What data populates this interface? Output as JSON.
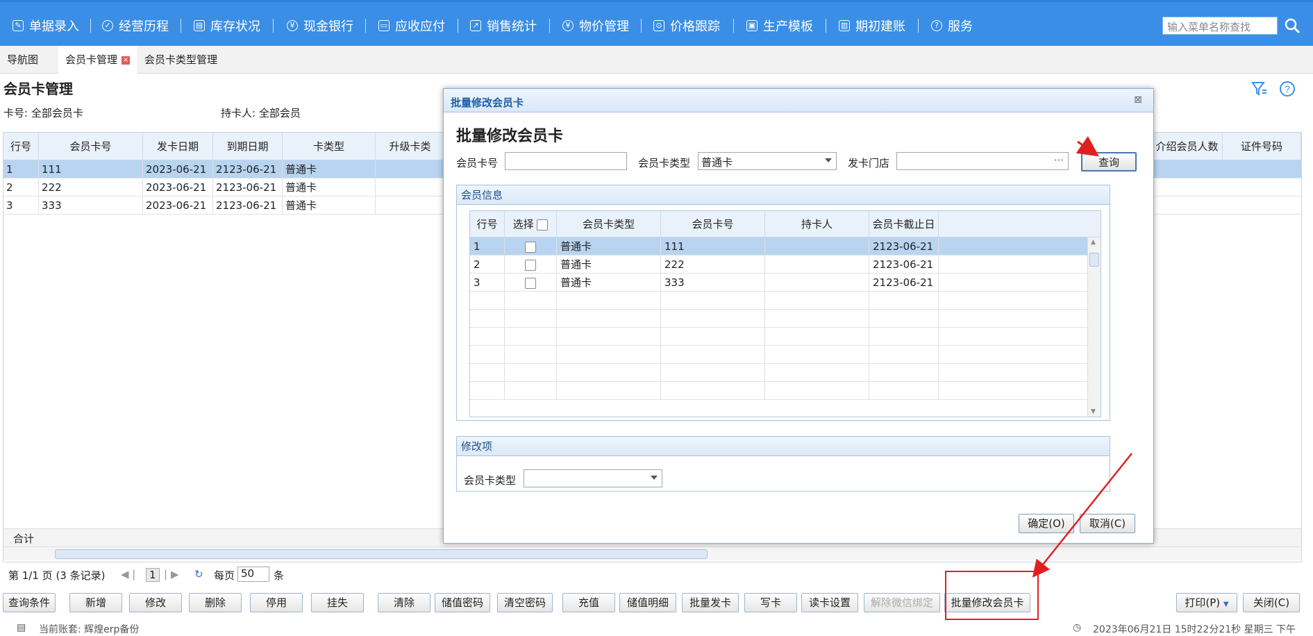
{
  "nav": {
    "items": [
      {
        "label": "单据录入",
        "icon": "edit-icon"
      },
      {
        "label": "经营历程",
        "icon": "check-circle-icon"
      },
      {
        "label": "库存状况",
        "icon": "calendar-icon"
      },
      {
        "label": "现金银行",
        "icon": "yen-icon"
      },
      {
        "label": "应收应付",
        "icon": "document-icon"
      },
      {
        "label": "销售统计",
        "icon": "chart-icon"
      },
      {
        "label": "物价管理",
        "icon": "yen-icon"
      },
      {
        "label": "价格跟踪",
        "icon": "tracking-icon"
      },
      {
        "label": "生产模板",
        "icon": "template-icon"
      },
      {
        "label": "期初建账",
        "icon": "ledger-icon"
      },
      {
        "label": "服务",
        "icon": "help-icon"
      }
    ],
    "search_placeholder": "输入菜单名称查找"
  },
  "tabs": [
    {
      "label": "导航图"
    },
    {
      "label": "会员卡管理",
      "active": true
    },
    {
      "label": "会员卡类型管理"
    }
  ],
  "page": {
    "title": "会员卡管理",
    "filter_card": "卡号:  全部会员卡",
    "filter_holder": "持卡人:  全部会员"
  },
  "grid": {
    "columns": [
      "行号",
      "会员卡号",
      "发卡日期",
      "到期日期",
      "卡类型",
      "升级卡类",
      "介绍会员人数",
      "证件号码"
    ],
    "rows": [
      {
        "n": "1",
        "card": "111",
        "issue": "2023-06-21",
        "expire": "2123-06-21",
        "type": "普通卡"
      },
      {
        "n": "2",
        "card": "222",
        "issue": "2023-06-21",
        "expire": "2123-06-21",
        "type": "普通卡"
      },
      {
        "n": "3",
        "card": "333",
        "issue": "2023-06-21",
        "expire": "2123-06-21",
        "type": "普通卡"
      }
    ],
    "footer_label": "合计"
  },
  "pager": {
    "summary": "第 1/1 页 (3 条记录)",
    "current_page": "1",
    "per_page_label": "每页",
    "per_page_value": "50",
    "unit": "条"
  },
  "buttons": [
    "查询条件",
    "新增",
    "修改",
    "删除",
    "停用",
    "挂失",
    "清除",
    "储值密码",
    "清空密码",
    "充值",
    "储值明细",
    "批量发卡",
    "写卡",
    "读卡设置",
    "解除微信绑定",
    "批量修改会员卡"
  ],
  "right_buttons": {
    "print": "打印(P)",
    "close": "关闭(C)"
  },
  "status": {
    "account": "当前账套:  辉煌erp备份",
    "datetime": "2023年06月21日 15时22分21秒 星期三 下午"
  },
  "dialog": {
    "title": "批量修改会员卡",
    "heading": "批量修改会员卡",
    "card_no_label": "会员卡号",
    "card_no_value": "",
    "card_type_label": "会员卡类型",
    "card_type_value": "普通卡",
    "store_label": "发卡门店",
    "store_value": "",
    "query_button": "查询",
    "member_panel_title": "会员信息",
    "inner_columns": [
      "行号",
      "选择",
      "会员卡类型",
      "会员卡号",
      "持卡人",
      "会员卡截止日"
    ],
    "inner_rows": [
      {
        "n": "1",
        "type": "普通卡",
        "card": "111",
        "holder": "",
        "expire": "2123-06-21"
      },
      {
        "n": "2",
        "type": "普通卡",
        "card": "222",
        "holder": "",
        "expire": "2123-06-21"
      },
      {
        "n": "3",
        "type": "普通卡",
        "card": "333",
        "holder": "",
        "expire": "2123-06-21"
      }
    ],
    "modify_panel_title": "修改项",
    "modify_type_label": "会员卡类型",
    "modify_type_value": "",
    "ok_button": "确定(O)",
    "cancel_button": "取消(C)"
  },
  "colors": {
    "nav_bg": "#3a8ee6",
    "selection": "#b8d4f0",
    "annotation": "#e02020"
  }
}
